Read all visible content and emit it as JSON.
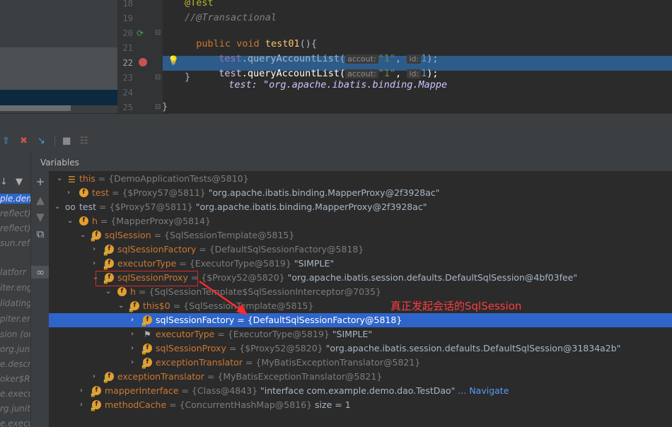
{
  "editor": {
    "lines": [
      {
        "num": "18",
        "text": "@Test"
      },
      {
        "num": "19",
        "text": "//@Transactional"
      },
      {
        "num": "20",
        "text": "public void test01(){"
      },
      {
        "num": "21",
        "text": "test.queryAccountList("
      },
      {
        "num": "22",
        "text": "test.queryAccountList("
      },
      {
        "num": "23",
        "text": "}"
      },
      {
        "num": "24",
        "text": ""
      },
      {
        "num": "25",
        "text": "}"
      }
    ],
    "hint_accout": "accout:",
    "hint_id": "id:",
    "arg_str": "\"1\"",
    "arg_num": "1",
    "inline_value": "test: \"org.apache.ibatis.binding.Mappe"
  },
  "debugger": {
    "vars_title": "Variables",
    "annotation": "真正发起会话的SqlSession",
    "frames": [
      "ple.dem",
      "reflect)",
      "reflect)",
      "sun.refl",
      "",
      "latforr",
      "iter.eng",
      "lidating",
      "piter.eng",
      "sion (or",
      "org.juni",
      "e.descri",
      "oker$R",
      "e.execu",
      "rg.junit.",
      "e.execu"
    ],
    "variables": [
      {
        "name": "this",
        "type": "{DemoApplicationTests@5810}",
        "value": ""
      },
      {
        "name": "test",
        "type": "{$Proxy57@5811}",
        "value": "\"org.apache.ibatis.binding.MapperProxy@2f3928ac\""
      },
      {
        "name": "test",
        "type": "{$Proxy57@5811}",
        "value": "\"org.apache.ibatis.binding.MapperProxy@2f3928ac\""
      },
      {
        "name": "h",
        "type": "{MapperProxy@5814}",
        "value": ""
      },
      {
        "name": "sqlSession",
        "type": "{SqlSessionTemplate@5815}",
        "value": ""
      },
      {
        "name": "sqlSessionFactory",
        "type": "{DefaultSqlSessionFactory@5818}",
        "value": ""
      },
      {
        "name": "executorType",
        "type": "{ExecutorType@5819}",
        "value": "\"SIMPLE\""
      },
      {
        "name": "sqlSessionProxy",
        "type": "{$Proxy52@5820}",
        "value": "\"org.apache.ibatis.session.defaults.DefaultSqlSession@4bf03fee\""
      },
      {
        "name": "h",
        "type": "{SqlSessionTemplate$SqlSessionInterceptor@7035}",
        "value": ""
      },
      {
        "name": "this$0",
        "type": "{SqlSessionTemplate@5815}",
        "value": ""
      },
      {
        "name": "sqlSessionFactory",
        "type": "{DefaultSqlSessionFactory@5818}",
        "value": ""
      },
      {
        "name": "executorType",
        "type": "{ExecutorType@5819}",
        "value": "\"SIMPLE\""
      },
      {
        "name": "sqlSessionProxy",
        "type": "{$Proxy52@5820}",
        "value": "\"org.apache.ibatis.session.defaults.DefaultSqlSession@31834a2b\""
      },
      {
        "name": "exceptionTranslator",
        "type": "{MyBatisExceptionTranslator@5821}",
        "value": ""
      },
      {
        "name": "exceptionTranslator",
        "type": "{MyBatisExceptionTranslator@5821}",
        "value": ""
      },
      {
        "name": "mapperInterface",
        "type": "{Class@4843}",
        "value": "\"interface com.example.demo.dao.TestDao\""
      },
      {
        "name": "methodCache",
        "type": "{ConcurrentHashMap@5816}",
        "value": " size = 1"
      }
    ],
    "navigate_label": "... Navigate"
  }
}
